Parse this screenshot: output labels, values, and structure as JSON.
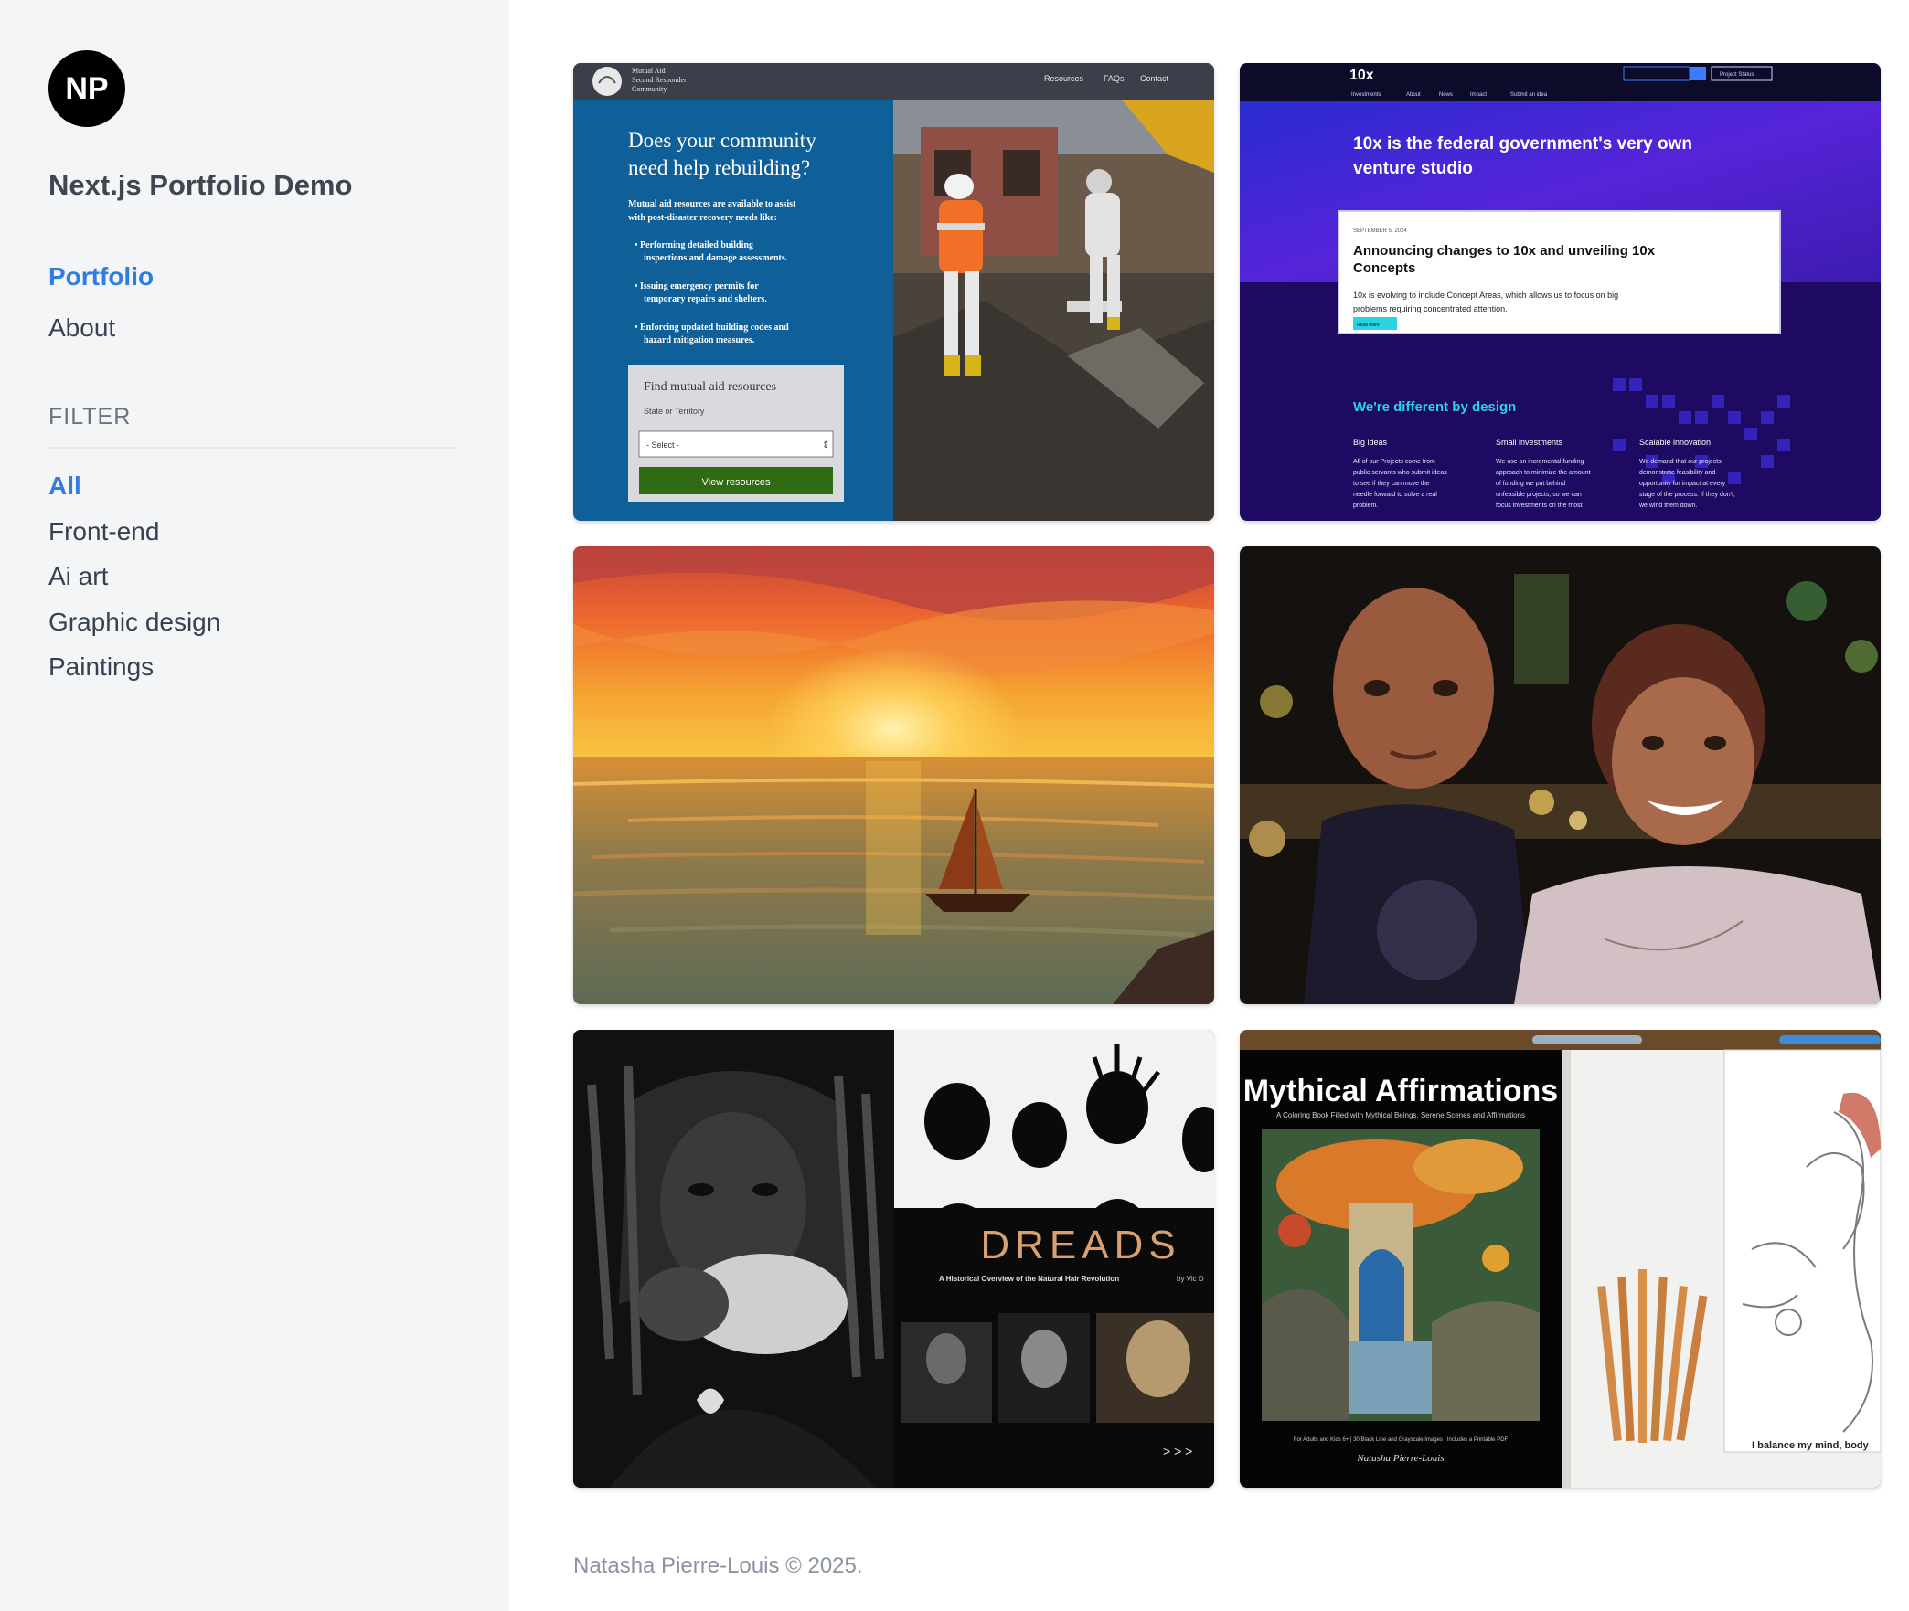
{
  "sidebar": {
    "avatar_initials": "NP",
    "site_title": "Next.js Portfolio Demo",
    "nav": [
      {
        "label": "Portfolio",
        "active": true
      },
      {
        "label": "About",
        "active": false
      }
    ],
    "filter_heading": "FILTER",
    "filters": [
      {
        "label": "All",
        "active": true
      },
      {
        "label": "Front-end",
        "active": false
      },
      {
        "label": "Ai art",
        "active": false
      },
      {
        "label": "Graphic design",
        "active": false
      },
      {
        "label": "Paintings",
        "active": false
      }
    ],
    "accent_color": "#2f7de1"
  },
  "gallery": {
    "tile1": {
      "logo_line1": "Mutual Aid",
      "logo_line2": "Second Responder",
      "logo_line3": "Community",
      "nav_resources": "Resources",
      "nav_faqs": "FAQs",
      "nav_contact": "Contact",
      "headline_line1": "Does your community",
      "headline_line2": "need help rebuilding?",
      "intro_line1": "Mutual aid resources are available to assist",
      "intro_line2": "with post-disaster recovery needs like:",
      "bullet1_line1": "Performing detailed building",
      "bullet1_line2": "inspections and damage assessments.",
      "bullet2_line1": "Issuing emergency permits for",
      "bullet2_line2": "temporary repairs and shelters.",
      "bullet3_line1": "Enforcing updated building codes and",
      "bullet3_line2": "hazard mitigation measures.",
      "card_title": "Find mutual aid resources",
      "card_label": "State or Territory",
      "select_value": "- Select -",
      "button_label": "View resources"
    },
    "tile2": {
      "logo": "10x",
      "nav_items": [
        "Investments",
        "About",
        "News",
        "Impact",
        "Submit an idea"
      ],
      "project_status": "Project Status",
      "headline_line1": "10x is the federal government's very own",
      "headline_line2": "venture studio",
      "card_date": "SEPTEMBER 5, 2024",
      "card_title_line1": "Announcing changes to 10x and unveiling 10x",
      "card_title_line2": "Concepts",
      "card_body_line1": "10x is evolving to include Concept Areas, which allows us to focus on big",
      "card_body_line2": "problems requiring concentrated attention.",
      "card_button": "Read more",
      "section_title": "We're different by design",
      "col1_title": "Big ideas",
      "col1_lines": [
        "All of our Projects come from",
        "public servants who submit ideas",
        "to see if they can move the",
        "needle forward to solve a real",
        "problem."
      ],
      "col2_title": "Small investments",
      "col2_lines": [
        "We use an incremental funding",
        "approach to minimize the amount",
        "of funding we put behind",
        "unfeasible projects, so we can",
        "focus investments on the most"
      ],
      "col3_title": "Scalable innovation",
      "col3_lines": [
        "We demand that our projects",
        "demonstrate feasibility and",
        "opportunity for impact at every",
        "stage of the process. If they don't,",
        "we wind them down."
      ]
    },
    "tile5": {
      "title": "DREADS",
      "subtitle": "A Historical Overview of the Natural Hair Revolution",
      "byline": "by Vic D",
      "arrows": "> > >"
    },
    "tile6": {
      "title": "Mythical Affirmations",
      "subtitle": "A Coloring Book Filled with Mythical Beings, Serene Scenes and Affirmations",
      "footer_line": "For Adults and Kids 6+ | 30 Black Line and Grayscale Images | Includes a Printable PDF",
      "author": "Natasha Pierre-Louis",
      "page_caption": "I balance my mind, body"
    }
  },
  "footer": {
    "text": "Natasha Pierre-Louis © 2025."
  }
}
